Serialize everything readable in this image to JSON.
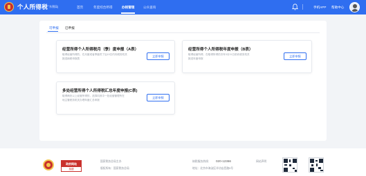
{
  "header": {
    "app_title": "个人所得税",
    "region": "[广东税局]",
    "nav": [
      {
        "label": "首页",
        "active": false
      },
      {
        "label": "年度综合所得",
        "active": false
      },
      {
        "label": "办税管理",
        "active": true
      },
      {
        "label": "公众查询",
        "active": false
      }
    ],
    "mobile_app": "手机APP",
    "help_center": "帮助中心"
  },
  "tabs": [
    {
      "label": "可申报",
      "active": true
    },
    {
      "label": "已申报",
      "active": false
    }
  ],
  "cards": [
    {
      "title": "经营所得个人所得税月（季）度申报（A表）",
      "desc": [
        "取得经营所得的，在月度或者季度终了后15日内向税务机关",
        "报送纳税申报表"
      ],
      "button": "立即申报"
    },
    {
      "title": "经营所得个人所得税年度申报（B表）",
      "desc": [
        "取得经营所得，在取得所得的次年3月31日前向税务机关",
        "报送年度申报"
      ],
      "button": "立即申报"
    },
    {
      "title": "多处经营所得个人所得税汇总年度申报(C表)",
      "desc": [
        "取得两处以上经营所得的，选择向其中一处经营管理所在",
        "地主管税务机关办理年度汇总申报"
      ],
      "button": "立即申报"
    }
  ],
  "footer": {
    "badge_top": "政府网站",
    "badge_bottom": "找错",
    "org_line1": "国家税务总局主办",
    "org_line2": "版权所有：国家税务总局",
    "hotline_label": "纳税服务热线：",
    "hotline_number": "020-12366",
    "address": "地址：北京市海淀区羊坊店西路5号",
    "contact": "网站声明"
  },
  "colors": {
    "primary": "#2f6ef0",
    "emblem_red": "#c9302c",
    "emblem_gold": "#f3c64f"
  }
}
